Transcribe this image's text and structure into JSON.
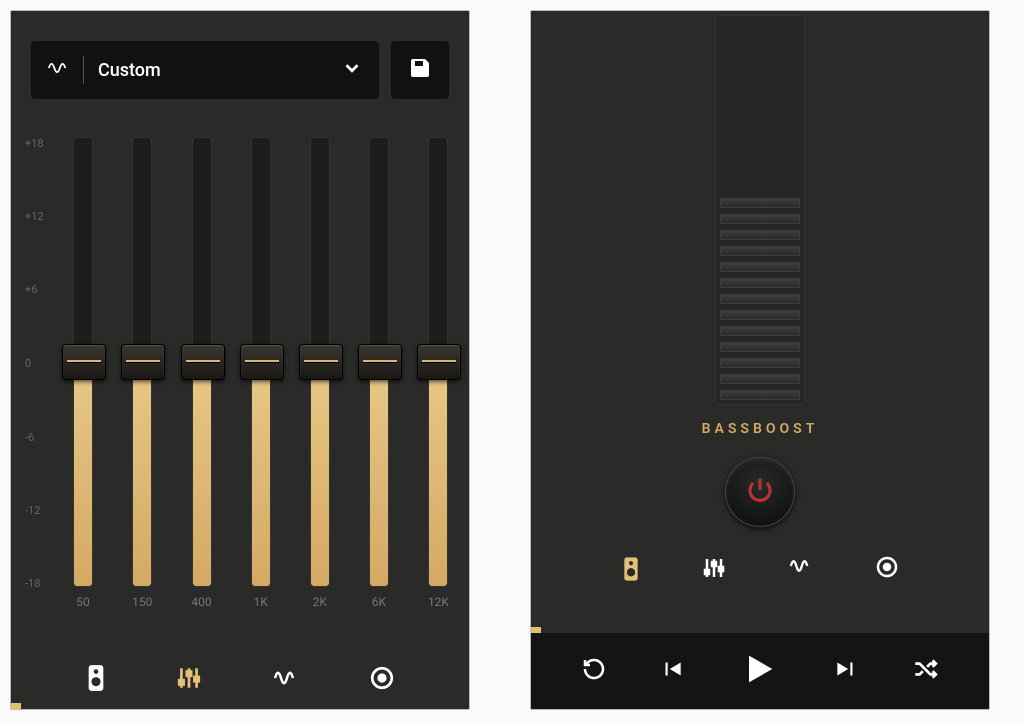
{
  "preset": {
    "label": "Custom"
  },
  "eq": {
    "scale": [
      "+18",
      "+12",
      "+6",
      "0",
      "-6",
      "-12",
      "-18"
    ],
    "bands": [
      {
        "freq": "50",
        "value": 0
      },
      {
        "freq": "150",
        "value": 0
      },
      {
        "freq": "400",
        "value": 0
      },
      {
        "freq": "1K",
        "value": 0
      },
      {
        "freq": "2K",
        "value": 0
      },
      {
        "freq": "6K",
        "value": 0
      },
      {
        "freq": "12K",
        "value": 0
      }
    ],
    "min": -18,
    "max": 18,
    "active_tab": "equalizer"
  },
  "bassboost": {
    "label": "BASSBOOST",
    "ticks": 13,
    "level": 0,
    "power": false,
    "active_tab": "speaker"
  },
  "nav_icons": {
    "speaker": "speaker-icon",
    "equalizer": "sliders-icon",
    "wave": "wave-icon",
    "dial": "dial-icon"
  },
  "playback": {
    "repeat": "repeat-icon",
    "prev": "skip-back-icon",
    "play": "play-icon",
    "next": "skip-forward-icon",
    "shuffle": "shuffle-icon"
  },
  "colors": {
    "accent": "#e5bf7a",
    "bg": "#2a2a28"
  }
}
